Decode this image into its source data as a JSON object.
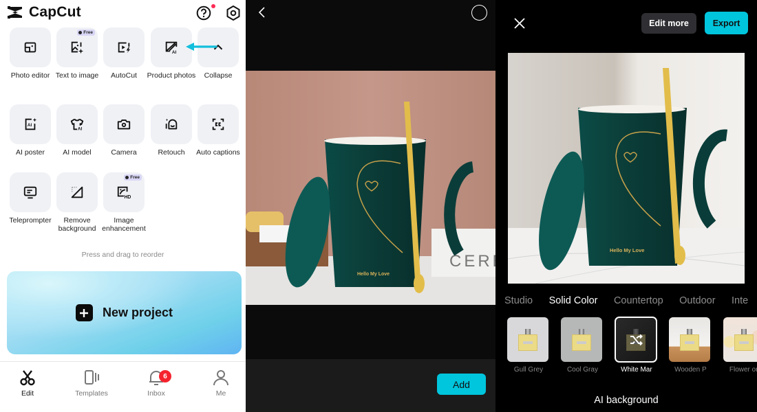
{
  "home": {
    "app_name": "CapCut",
    "tools": [
      {
        "label": "Photo editor",
        "icon": "photo-editor-icon",
        "free": false
      },
      {
        "label": "Text to image",
        "icon": "text-to-image-icon",
        "free": true
      },
      {
        "label": "AutoCut",
        "icon": "autocut-icon",
        "free": false
      },
      {
        "label": "Product photos",
        "icon": "product-photos-icon",
        "free": false
      },
      {
        "label": "Collapse",
        "icon": "chevron-up-icon",
        "free": false
      },
      {
        "label": "AI poster",
        "icon": "ai-poster-icon",
        "free": false
      },
      {
        "label": "AI model",
        "icon": "ai-model-icon",
        "free": false
      },
      {
        "label": "Camera",
        "icon": "camera-icon",
        "free": false
      },
      {
        "label": "Retouch",
        "icon": "retouch-icon",
        "free": false
      },
      {
        "label": "Auto captions",
        "icon": "auto-captions-icon",
        "free": false
      },
      {
        "label": "Teleprompter",
        "icon": "teleprompter-icon",
        "free": false
      },
      {
        "label": "Remove background",
        "icon": "remove-background-icon",
        "free": false
      },
      {
        "label": "Image enhancement",
        "icon": "image-enhancement-icon",
        "free": true
      }
    ],
    "free_badge": "Free",
    "reorder_hint": "Press and drag to reorder",
    "new_project_label": "New project",
    "nav": [
      {
        "label": "Edit",
        "icon": "scissors-icon",
        "active": true
      },
      {
        "label": "Templates",
        "icon": "templates-icon",
        "active": false
      },
      {
        "label": "Inbox",
        "icon": "bell-icon",
        "active": false,
        "badge": "6"
      },
      {
        "label": "Me",
        "icon": "person-icon",
        "active": false
      }
    ],
    "accent_color": "#00c6dd",
    "badge_color": "#f5222d"
  },
  "picker": {
    "photo_text": [
      "Hello My Love",
      "CERE"
    ],
    "add_label": "Add"
  },
  "ai_background": {
    "edit_more_label": "Edit more",
    "export_label": "Export",
    "categories": [
      "Studio",
      "Solid Color",
      "Countertop",
      "Outdoor",
      "Inte"
    ],
    "active_category": "Solid Color",
    "thumbnails": [
      {
        "label": "Gull Grey",
        "selected": false
      },
      {
        "label": "Cool Gray",
        "selected": false
      },
      {
        "label": "White Mar",
        "selected": true
      },
      {
        "label": "Wooden P",
        "selected": false
      },
      {
        "label": "Flower on",
        "selected": false
      }
    ],
    "title": "AI background",
    "photo_text": "Hello My Love"
  }
}
